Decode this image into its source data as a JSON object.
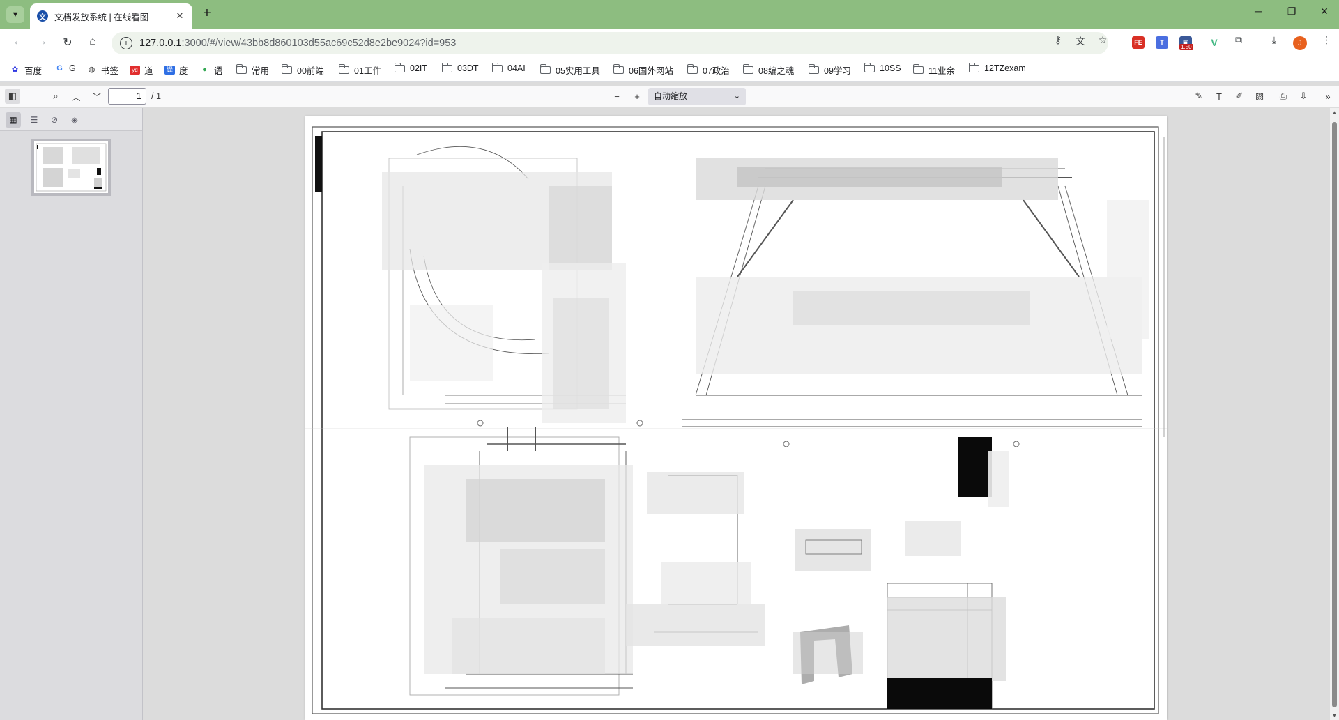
{
  "browser": {
    "tab": {
      "title": "文档发放系统 | 在线看图",
      "favicon_letter": "文"
    },
    "new_tab_label": "+",
    "url": {
      "host": "127.0.0.1",
      "path": ":3000/#/view/43bb8d860103d55ac69c52d8e2be9024?id=953"
    },
    "extension_badge": "1.50",
    "avatar_letter": "J"
  },
  "bookmarks": [
    {
      "label": "百度",
      "icon": "baidu-icon"
    },
    {
      "label": "G",
      "icon": "google-icon"
    },
    {
      "label": "书签",
      "icon": "globe-icon"
    },
    {
      "label": "道",
      "icon": "youdao-icon"
    },
    {
      "label": "度",
      "icon": "translate-icon"
    },
    {
      "label": "语",
      "icon": "leaf-icon"
    },
    {
      "label": "常用",
      "icon": "folder-icon"
    },
    {
      "label": "00前端",
      "icon": "folder-icon"
    },
    {
      "label": "01工作",
      "icon": "folder-icon"
    },
    {
      "label": "02IT",
      "icon": "folder-icon"
    },
    {
      "label": "03DT",
      "icon": "folder-icon"
    },
    {
      "label": "04AI",
      "icon": "folder-icon"
    },
    {
      "label": "05实用工具",
      "icon": "folder-icon"
    },
    {
      "label": "06国外网站",
      "icon": "folder-icon"
    },
    {
      "label": "07政治",
      "icon": "folder-icon"
    },
    {
      "label": "08编之魂",
      "icon": "folder-icon"
    },
    {
      "label": "09学习",
      "icon": "folder-icon"
    },
    {
      "label": "10SS",
      "icon": "folder-icon"
    },
    {
      "label": "11业余",
      "icon": "folder-icon"
    },
    {
      "label": "12TZexam",
      "icon": "folder-icon"
    }
  ],
  "viewer": {
    "page_number": "1",
    "page_count": "/ 1",
    "zoom_label": "自动缩放"
  }
}
